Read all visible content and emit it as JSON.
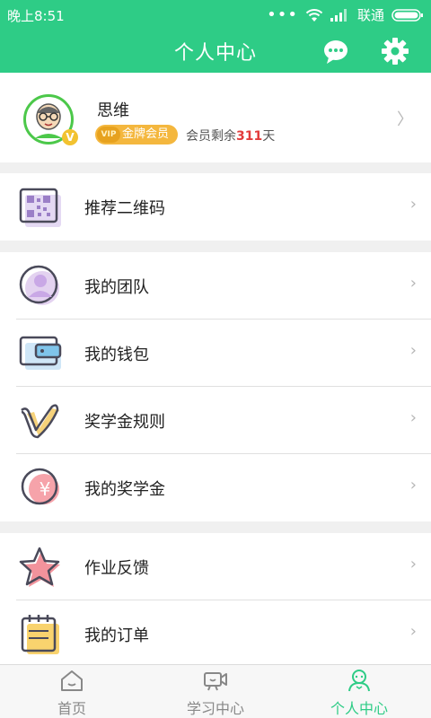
{
  "status_bar": {
    "time": "晚上8:51",
    "carrier": "联通"
  },
  "header": {
    "title": "个人中心",
    "chat_icon": "chat-bubble-icon",
    "settings_icon": "gear-icon"
  },
  "profile": {
    "name": "思维",
    "vip_badge": "VIP",
    "membership_label": "金牌会员",
    "remaining_prefix": "会员剩余",
    "remaining_days": "311",
    "remaining_suffix": "天"
  },
  "menu": {
    "qrcode": "推荐二维码",
    "team": "我的团队",
    "wallet": "我的钱包",
    "scholarship_rules": "奖学金规则",
    "my_scholarship": "我的奖学金",
    "yen_symbol": "¥",
    "homework_feedback": "作业反馈",
    "my_orders": "我的订单"
  },
  "tabs": {
    "home": "首页",
    "study": "学习中心",
    "me": "个人中心"
  },
  "colors": {
    "primary": "#2ecc86",
    "badge_gold": "#f4b73e",
    "days_red": "#e23b3b"
  }
}
